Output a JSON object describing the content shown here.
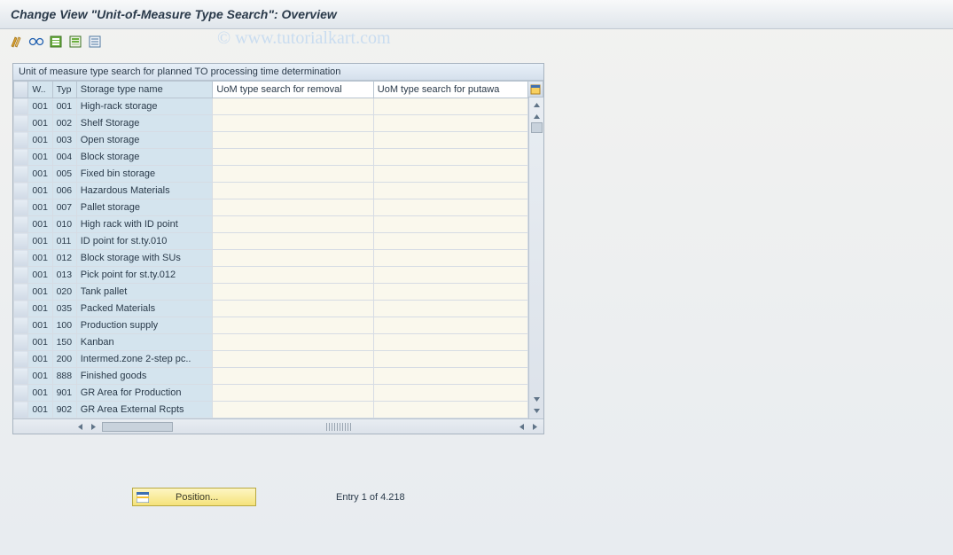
{
  "header": {
    "title": "Change View \"Unit-of-Measure Type Search\": Overview"
  },
  "watermark": "© www.tutorialkart.com",
  "toolbar": {
    "icons": [
      "pencil-double-icon",
      "glasses-icon",
      "small-green-icon",
      "sheet-green-icon",
      "sheet-blue-icon"
    ]
  },
  "table": {
    "caption": "Unit of measure type search for planned TO processing time determination",
    "columns": {
      "w": "W..",
      "typ": "Typ",
      "name": "Storage type name",
      "removal": "UoM type search for removal",
      "putaway": "UoM type search for putawa"
    },
    "rows": [
      {
        "w": "001",
        "typ": "001",
        "name": "High-rack storage",
        "rem": "",
        "put": ""
      },
      {
        "w": "001",
        "typ": "002",
        "name": "Shelf Storage",
        "rem": "",
        "put": ""
      },
      {
        "w": "001",
        "typ": "003",
        "name": "Open storage",
        "rem": "",
        "put": ""
      },
      {
        "w": "001",
        "typ": "004",
        "name": "Block storage",
        "rem": "",
        "put": ""
      },
      {
        "w": "001",
        "typ": "005",
        "name": "Fixed bin storage",
        "rem": "",
        "put": ""
      },
      {
        "w": "001",
        "typ": "006",
        "name": "Hazardous Materials",
        "rem": "",
        "put": ""
      },
      {
        "w": "001",
        "typ": "007",
        "name": "Pallet storage",
        "rem": "",
        "put": ""
      },
      {
        "w": "001",
        "typ": "010",
        "name": "High rack with ID point",
        "rem": "",
        "put": ""
      },
      {
        "w": "001",
        "typ": "011",
        "name": "ID point for st.ty.010",
        "rem": "",
        "put": ""
      },
      {
        "w": "001",
        "typ": "012",
        "name": "Block storage with SUs",
        "rem": "",
        "put": ""
      },
      {
        "w": "001",
        "typ": "013",
        "name": "Pick point for st.ty.012",
        "rem": "",
        "put": ""
      },
      {
        "w": "001",
        "typ": "020",
        "name": "Tank pallet",
        "rem": "",
        "put": ""
      },
      {
        "w": "001",
        "typ": "035",
        "name": "Packed Materials",
        "rem": "",
        "put": ""
      },
      {
        "w": "001",
        "typ": "100",
        "name": "Production supply",
        "rem": "",
        "put": ""
      },
      {
        "w": "001",
        "typ": "150",
        "name": "Kanban",
        "rem": "",
        "put": ""
      },
      {
        "w": "001",
        "typ": "200",
        "name": "Intermed.zone 2-step pc..",
        "rem": "",
        "put": ""
      },
      {
        "w": "001",
        "typ": "888",
        "name": "Finished goods",
        "rem": "",
        "put": ""
      },
      {
        "w": "001",
        "typ": "901",
        "name": "GR Area for Production",
        "rem": "",
        "put": ""
      },
      {
        "w": "001",
        "typ": "902",
        "name": "GR Area External Rcpts",
        "rem": "",
        "put": ""
      }
    ]
  },
  "footer": {
    "position_label": "Position...",
    "entry_info": "Entry 1 of 4.218"
  }
}
